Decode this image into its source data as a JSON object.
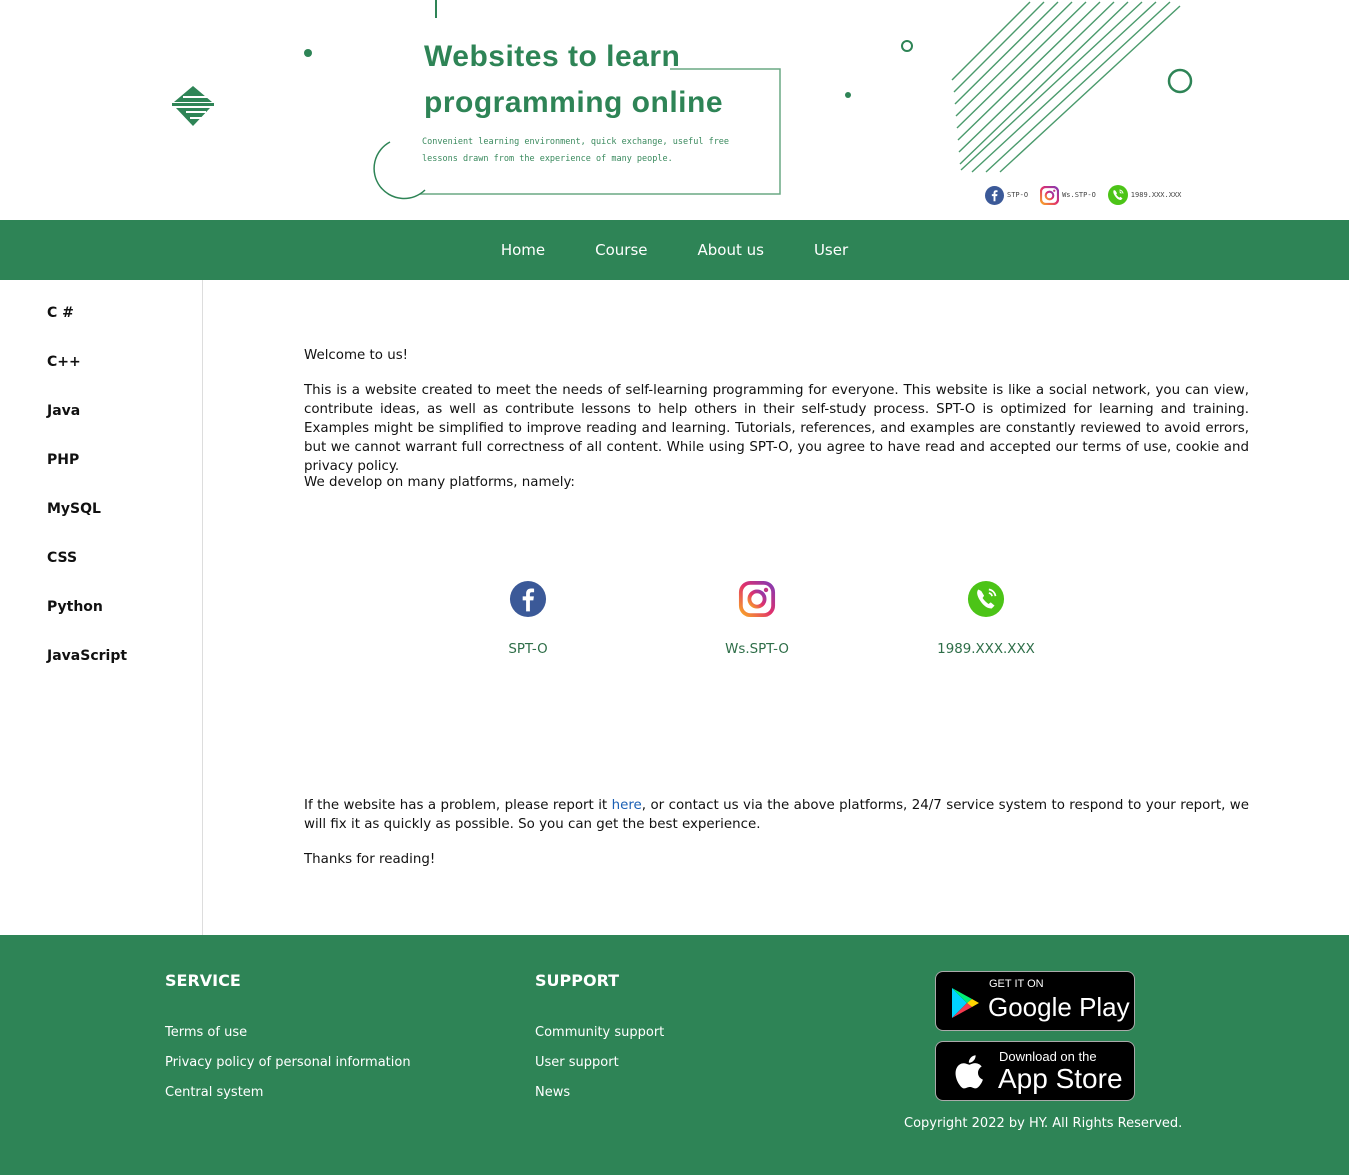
{
  "header": {
    "title": "Websites to learn programming online",
    "tagline": "Convenient learning environment, quick exchange, useful free lessons drawn from the experience of many people.",
    "contacts": [
      {
        "icon": "facebook-icon",
        "label": "STP-O"
      },
      {
        "icon": "instagram-icon",
        "label": "Ws.STP-O"
      },
      {
        "icon": "phone-icon",
        "label": "1989.XXX.XXX"
      }
    ]
  },
  "nav": {
    "items": [
      "Home",
      "Course",
      "About us",
      "User"
    ]
  },
  "sidebar": {
    "items": [
      "C #",
      "C++",
      "Java",
      "PHP",
      "MySQL",
      "CSS",
      "Python",
      "JavaScript"
    ]
  },
  "content": {
    "welcome": "Welcome to us!",
    "intro": "This is a website created to meet the needs of self-learning programming for everyone. This website is like a social network, you can view, contribute ideas, as well as contribute lessons to help others in their self-study process. SPT-O is optimized for learning and training. Examples might be simplified to improve reading and learning. Tutorials, references, and examples are constantly reviewed to avoid errors, but we cannot warrant full correctness of all content. While using SPT-O, you agree to have read and accepted our terms of use, cookie and privacy policy.",
    "platforms_intro": "We develop on many platforms, namely:",
    "platforms": [
      {
        "icon": "facebook-icon",
        "label": "SPT-O"
      },
      {
        "icon": "instagram-icon",
        "label": "Ws.SPT-O"
      },
      {
        "icon": "phone-icon",
        "label": "1989.XXX.XXX"
      }
    ],
    "report_before": "If the website has a problem, please report it ",
    "report_link": "here",
    "report_after": ", or contact us via the above platforms, 24/7 service system to respond to your report, we will fix it as quickly as possible. So you can get the best experience.",
    "thanks": "Thanks for reading!"
  },
  "footer": {
    "service": {
      "heading": "SERVICE",
      "links": [
        "Terms of use",
        "Privacy policy of personal information",
        "Central system"
      ]
    },
    "support": {
      "heading": "SUPPORT",
      "links": [
        "Community support",
        "User support",
        "News"
      ]
    },
    "google_play": {
      "small": "GET IT ON",
      "big": "Google Play"
    },
    "app_store": {
      "small": "Download on the",
      "big": "App Store"
    },
    "copyright": "Copyright 2022 by HY. All Rights Reserved."
  },
  "colors": {
    "brand_green": "#2e8456",
    "link_blue": "#1a5fb4",
    "facebook_blue": "#3b5998",
    "phone_green": "#4cc417"
  }
}
